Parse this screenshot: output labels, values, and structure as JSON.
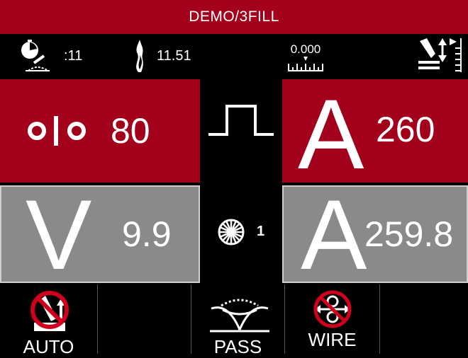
{
  "title": "DEMO/3FILL",
  "status": {
    "timer_value": ":11",
    "heat_value": "11.51",
    "scale_value": "0.000"
  },
  "panels": {
    "top_left_value": "80",
    "top_right_symbol": "A",
    "top_right_value": "260",
    "bottom_left_symbol": "V",
    "bottom_left_value": "9.9",
    "bottom_right_symbol": "A",
    "bottom_right_value": "259.8"
  },
  "center": {
    "spinner_count": "1"
  },
  "bottom_bar": {
    "auto_label": "AUTO",
    "pass_label": "PASS",
    "wire_label": "WIRE"
  },
  "colors": {
    "accent_red": "#a3001b",
    "panel_gray": "#8a8a8a"
  }
}
